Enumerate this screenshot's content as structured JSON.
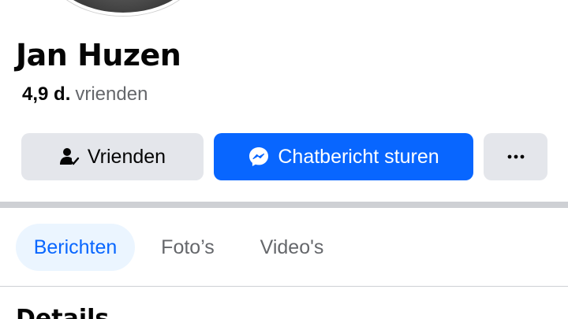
{
  "profile": {
    "name": "Jan Huzen",
    "friends_count": "4,9 d.",
    "friends_label": "vrienden"
  },
  "actions": {
    "friends_label": "Vrienden",
    "friends_icon": "friend-check-icon",
    "message_label": "Chatbericht sturen",
    "message_icon": "messenger-icon",
    "more_label": "···",
    "more_icon": "more-dots-icon"
  },
  "tabs": [
    {
      "label": "Berichten",
      "active": true
    },
    {
      "label": "Foto’s",
      "active": false
    },
    {
      "label": "Video's",
      "active": false
    }
  ],
  "section": {
    "title": "Details"
  },
  "colors": {
    "accent": "#0866ff",
    "button_gray": "#e4e6eb",
    "active_tab_bg": "#ebf5ff",
    "divider": "#ced0d4"
  }
}
